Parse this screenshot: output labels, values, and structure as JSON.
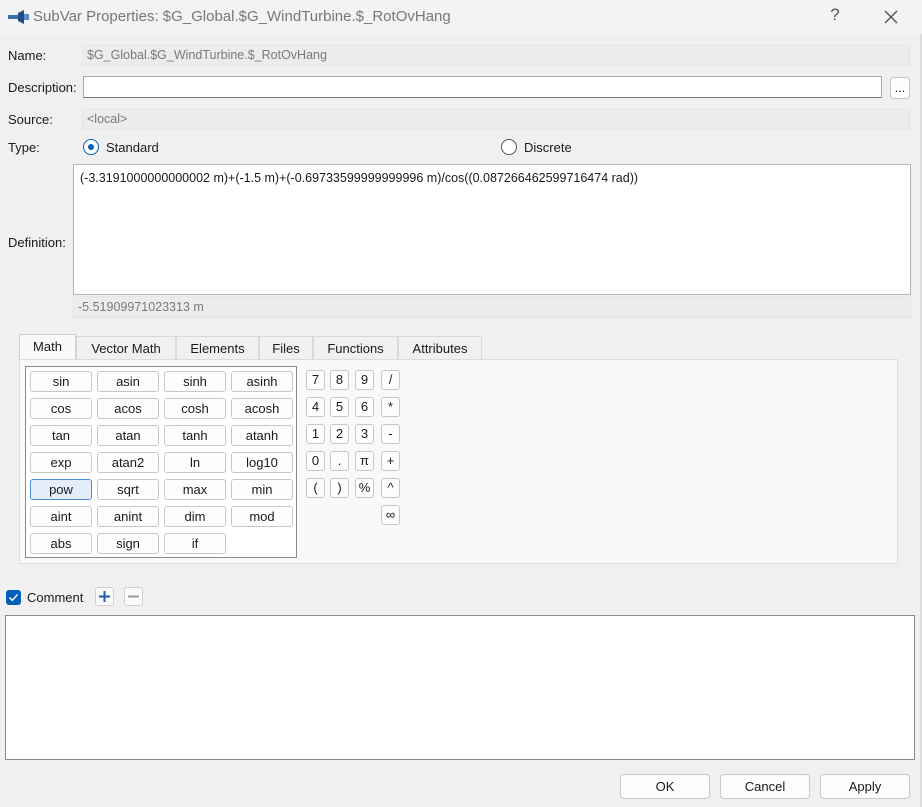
{
  "window": {
    "title": "SubVar Properties: $G_Global.$G_WindTurbine.$_RotOvHang",
    "help_glyph": "?"
  },
  "form": {
    "name_label": "Name:",
    "name_value": "$G_Global.$G_WindTurbine.$_RotOvHang",
    "description_label": "Description:",
    "description_value": "",
    "description_browse": "...",
    "source_label": "Source:",
    "source_value": "<local>",
    "type_label": "Type:",
    "type_standard": "Standard",
    "type_discrete": "Discrete",
    "type_selected": "Standard",
    "definition_label": "Definition:",
    "definition_value": "(-3.3191000000000002 m)+(-1.5 m)+(-0.69733599999999996 m)/cos((0.087266462599716474 rad))",
    "result_value": "-5.51909971023313 m"
  },
  "tabs": [
    "Math",
    "Vector Math",
    "Elements",
    "Files",
    "Functions",
    "Attributes"
  ],
  "active_tab": "Math",
  "functions": [
    [
      "sin",
      "asin",
      "sinh",
      "asinh"
    ],
    [
      "cos",
      "acos",
      "cosh",
      "acosh"
    ],
    [
      "tan",
      "atan",
      "tanh",
      "atanh"
    ],
    [
      "exp",
      "atan2",
      "ln",
      "log10"
    ],
    [
      "pow",
      "sqrt",
      "max",
      "min"
    ],
    [
      "aint",
      "anint",
      "dim",
      "mod"
    ],
    [
      "abs",
      "sign",
      "if"
    ]
  ],
  "selected_function": "pow",
  "keypad": [
    [
      "7",
      "8",
      "9",
      "/"
    ],
    [
      "4",
      "5",
      "6",
      "*"
    ],
    [
      "1",
      "2",
      "3",
      "-"
    ],
    [
      "0",
      ".",
      "π",
      "+"
    ],
    [
      "(",
      ")",
      "%",
      "^"
    ],
    [
      "",
      "",
      "",
      "∞"
    ]
  ],
  "comment": {
    "label": "Comment",
    "checked": true,
    "value": ""
  },
  "buttons": {
    "ok": "OK",
    "cancel": "Cancel",
    "apply": "Apply"
  },
  "colors": {
    "accent": "#005fb8",
    "background": "#f0f0f0"
  }
}
